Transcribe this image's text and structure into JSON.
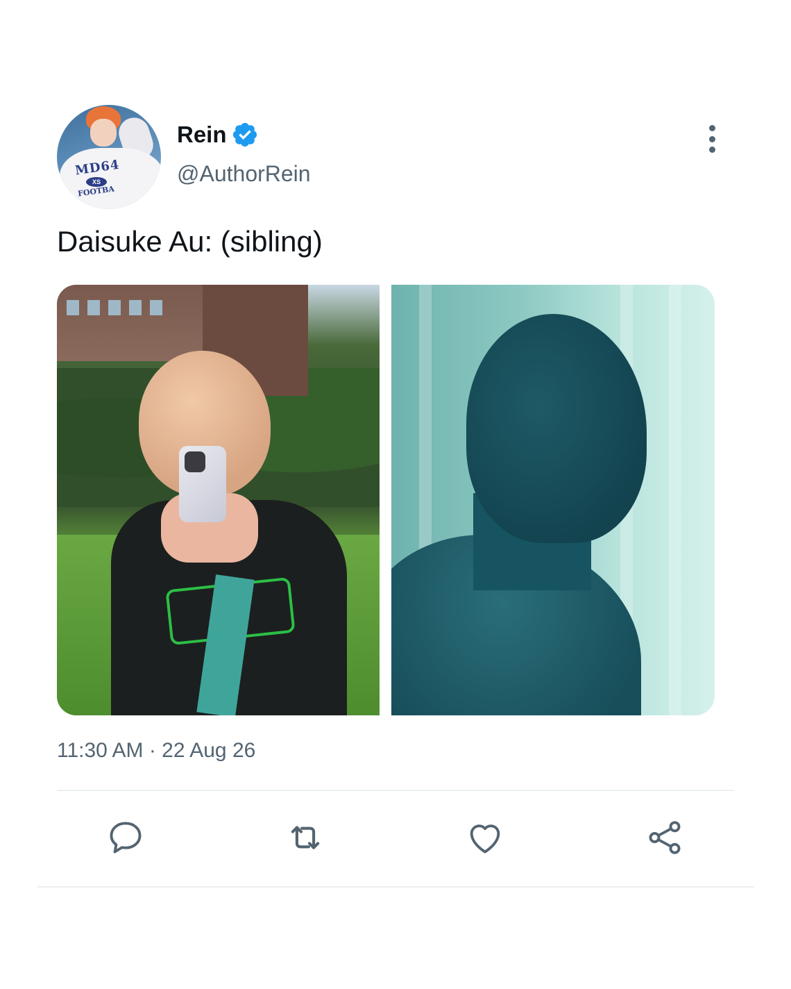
{
  "tweet": {
    "author": {
      "display_name": "Rein",
      "handle": "@AuthorRein",
      "verified": true,
      "avatar_shirt_text": "MD64",
      "avatar_shirt_size": "XS",
      "avatar_shirt_sub": "FOOTBA"
    },
    "text": "Daisuke Au: (sibling)",
    "timestamp": "11:30 AM · 22 Aug 26",
    "media": [
      {
        "name": "photo-mirror-selfie"
      },
      {
        "name": "photo-silhouette"
      }
    ],
    "actions": [
      {
        "name": "reply",
        "icon": "comment-icon"
      },
      {
        "name": "retweet",
        "icon": "retweet-icon"
      },
      {
        "name": "like",
        "icon": "heart-icon"
      },
      {
        "name": "share",
        "icon": "share-icon"
      }
    ]
  },
  "colors": {
    "text_primary": "#0f1419",
    "text_secondary": "#536471",
    "verified_blue": "#1d9bf0",
    "divider": "#eceff1"
  }
}
